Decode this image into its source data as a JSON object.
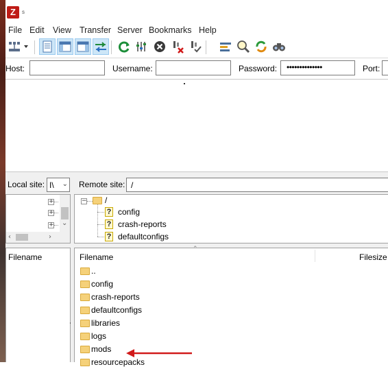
{
  "window": {
    "title": "s"
  },
  "menu": [
    "File",
    "Edit",
    "View",
    "Transfer",
    "Server",
    "Bookmarks",
    "Help"
  ],
  "toolbar": {
    "icons": [
      "site-manager-icon",
      "dropdown-arrow-icon",
      "toggle-message-log-icon",
      "toggle-local-tree-icon",
      "toggle-remote-tree-icon",
      "toggle-transfer-queue-icon",
      "refresh-icon",
      "process-queue-icon",
      "cancel-icon",
      "disconnect-icon",
      "reconnect-icon",
      "directory-filter-icon",
      "toggle-comparison-icon",
      "sync-browsing-icon",
      "find-files-icon"
    ]
  },
  "quickconnect": {
    "host_label": "Host:",
    "host_value": "",
    "username_label": "Username:",
    "username_value": "",
    "password_label": "Password:",
    "password_value": "••••••••••••••",
    "port_label": "Port:"
  },
  "local": {
    "site_label": "Local site:",
    "site_value": "I\\",
    "filename_header": "Filename"
  },
  "remote": {
    "site_label": "Remote site:",
    "site_value": "/",
    "tree_root": "/",
    "tree_children": [
      "config",
      "crash-reports",
      "defaultconfigs"
    ],
    "filename_header": "Filename",
    "filesize_header": "Filesize",
    "files": [
      "..",
      "config",
      "crash-reports",
      "defaultconfigs",
      "libraries",
      "logs",
      "mods",
      "resourcepacks"
    ]
  },
  "colors": {
    "folder": "#f5d17a",
    "annotation_arrow": "#d11a1a",
    "toggle_active": "#cde6f7"
  }
}
